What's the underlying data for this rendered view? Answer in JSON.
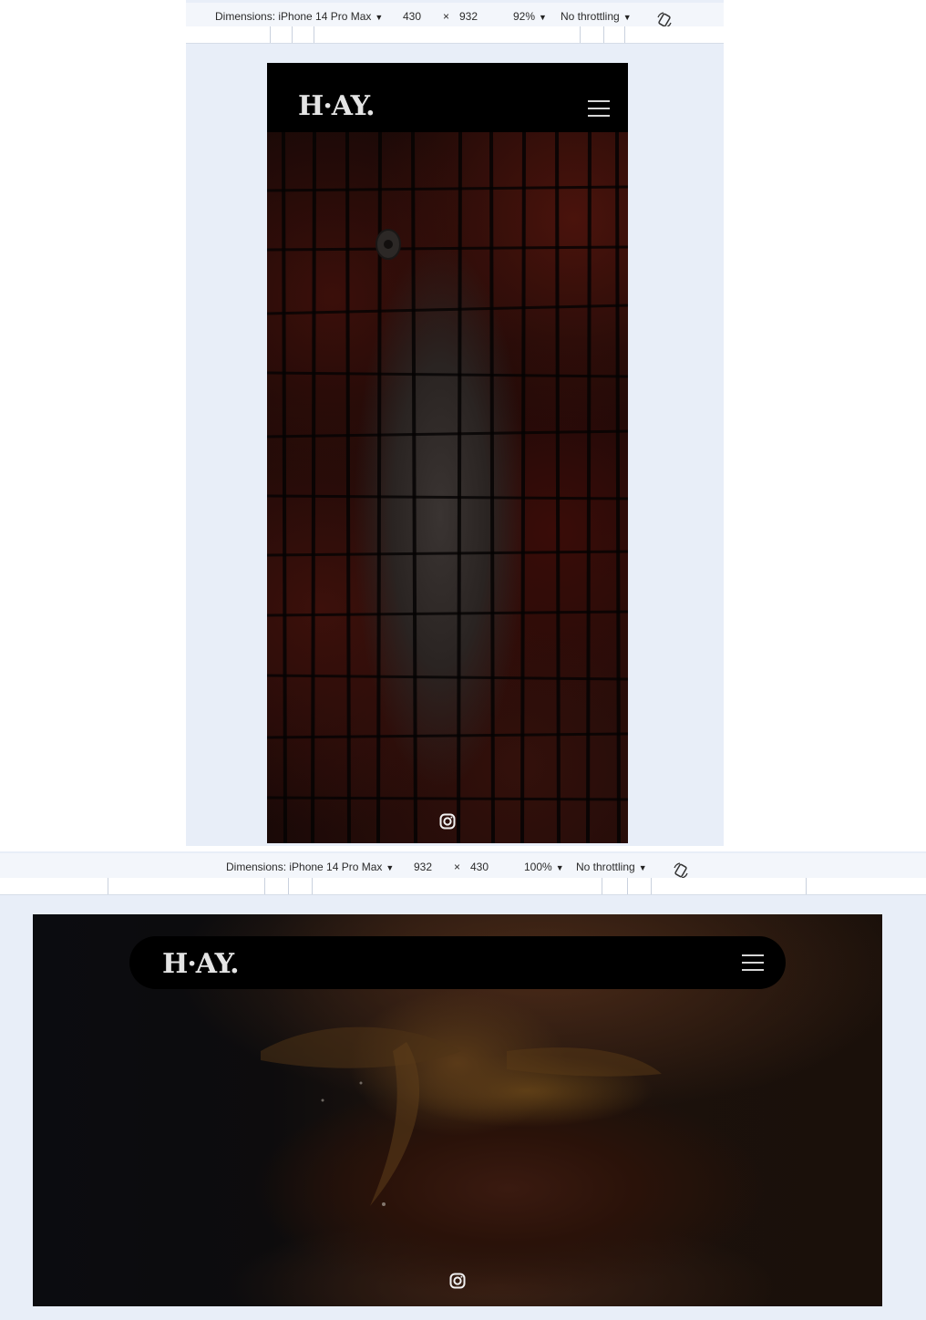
{
  "top_toolbar": {
    "dimensions_label": "Dimensions: iPhone 14 Pro Max",
    "width": "430",
    "times": "×",
    "height": "932",
    "zoom": "92%",
    "throttling": "No throttling"
  },
  "bottom_toolbar": {
    "dimensions_label": "Dimensions: iPhone 14 Pro Max",
    "width": "932",
    "times": "×",
    "height": "430",
    "zoom": "100%",
    "throttling": "No throttling"
  },
  "site": {
    "logo": "H·AY.",
    "menu_icon": "hamburger-menu-icon",
    "social_icon": "instagram-icon"
  },
  "icons": {
    "rotate": "rotate-device-icon",
    "dropdown": "chevron-down-icon"
  },
  "colors": {
    "devtools_bg": "#e8eef8",
    "nav_bg": "#000000",
    "logo_color": "#e4e4e4"
  }
}
